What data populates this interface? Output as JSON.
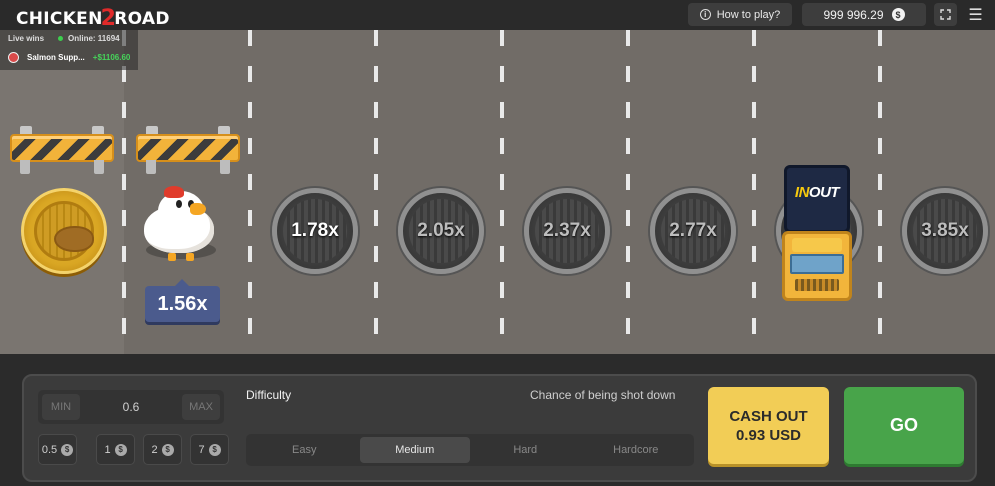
{
  "header": {
    "logo_left": "CHICKEN",
    "logo_mid": "2",
    "logo_right": "ROAD",
    "how_to_play": "How to play?",
    "balance": "999 996.29",
    "currency_symbol": "$"
  },
  "live": {
    "label": "Live wins",
    "online_label": "Online: 11694",
    "recent_win": {
      "user": "Salmon Supp...",
      "amount": "+$1106.60"
    }
  },
  "lanes": {
    "current_multiplier": "1.56x",
    "manholes": [
      "1.78x",
      "2.05x",
      "2.37x",
      "2.77x",
      "3.85x"
    ]
  },
  "truck": {
    "logo_in": "IN",
    "logo_out": "OUT"
  },
  "controls": {
    "min_label": "MIN",
    "max_label": "MAX",
    "bet_value": "0.6",
    "chips": [
      "0.5",
      "1",
      "2",
      "7"
    ],
    "difficulty_label": "Difficulty",
    "chance_label": "Chance of being shot down",
    "difficulties": [
      "Easy",
      "Medium",
      "Hard",
      "Hardcore"
    ],
    "active_difficulty": "Medium",
    "cashout_line1": "CASH OUT",
    "cashout_line2": "0.93 USD",
    "go_label": "GO"
  },
  "colors": {
    "road": "#716c67",
    "cashout": "#f2cd56",
    "go": "#48a44a",
    "badge": "#4b5b8d"
  }
}
